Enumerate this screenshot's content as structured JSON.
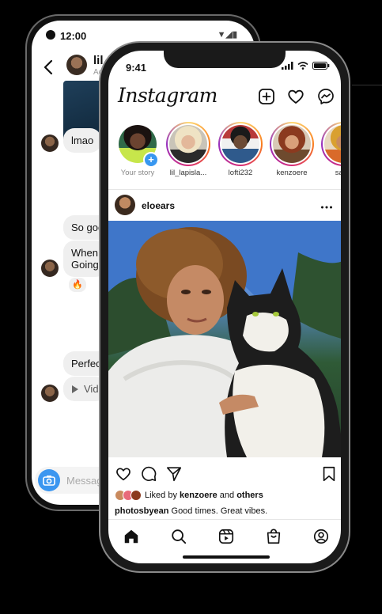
{
  "back_phone": {
    "status_time": "12:00",
    "status_icons": "▼◢▮",
    "header": {
      "back_icon": "back-arrow-icon",
      "contact_name": "lil_la",
      "contact_status": "Acti"
    },
    "messages": [
      {
        "text": "lmao"
      },
      {
        "text": "So goo"
      },
      {
        "text": "When\nGoing"
      },
      {
        "text": "Perfec"
      },
      {
        "text": "Vid",
        "icon": "play-icon"
      }
    ],
    "reaction": "🔥",
    "composer": {
      "placeholder": "Message",
      "camera_icon": "camera-icon"
    }
  },
  "front_phone": {
    "status_time": "9:41",
    "app_logo": "Instagram",
    "header_icons": [
      "new-post-icon",
      "heart-icon",
      "messenger-icon"
    ],
    "stories": [
      {
        "label": "Your story",
        "own": true,
        "skin": "#6b4330",
        "hair": "#1a1210",
        "shirt": "#c7e64b"
      },
      {
        "label": "lil_lapisla...",
        "skin": "#e3b89a",
        "hair": "#efe3c4",
        "shirt": "#2b2b2b"
      },
      {
        "label": "lofti232",
        "skin": "#6b4a35",
        "hair": "#1a1a1a",
        "shirt": "#2f5a8c"
      },
      {
        "label": "kenzoere",
        "skin": "#d9a07a",
        "hair": "#8b3a1f",
        "shirt": "#6e4a2e"
      },
      {
        "label": "sapp",
        "skin": "#c98a5e",
        "hair": "#d9a030",
        "shirt": "#d96a2a"
      }
    ],
    "post": {
      "username": "eloears",
      "more_icon": "more-icon",
      "liked_by_prefix": "Liked by ",
      "liked_by_user": "kenzoere",
      "liked_by_and": " and ",
      "liked_by_others": "others",
      "caption_user": "photosbyean",
      "caption_text": " Good times. Great vibes."
    },
    "actions": [
      "like-icon",
      "comment-icon",
      "share-icon",
      "save-icon"
    ],
    "tabs": [
      "home-icon",
      "search-icon",
      "reels-icon",
      "shop-icon",
      "profile-icon"
    ],
    "colors": {
      "story_ring_start": "#feda75",
      "story_ring_end": "#962fbf",
      "plus_blue": "#3897f0"
    }
  }
}
